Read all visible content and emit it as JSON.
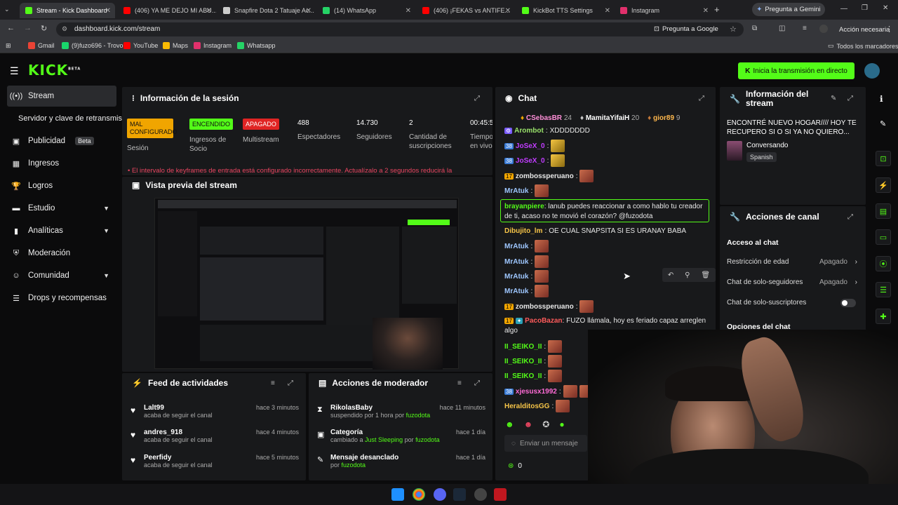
{
  "browser": {
    "tabs": [
      {
        "label": "Stream - Kick Dashboard",
        "color": "#53fc18",
        "active": true
      },
      {
        "label": "(406) YA ME DEJO MI ABU...",
        "color": "#ff0000"
      },
      {
        "label": "Snapfire Dota 2 Tatuaje Ac...",
        "color": "#cccccc"
      },
      {
        "label": "(14) WhatsApp",
        "color": "#25d366"
      },
      {
        "label": "(406) ¡FEKAS vs ANTIFE...",
        "color": "#ff0000"
      },
      {
        "label": "KickBot TTS Settings",
        "color": "#53fc18"
      },
      {
        "label": "Instagram",
        "color": "#e1306c"
      }
    ],
    "gemini_button": "Pregunta a Gemini",
    "url": "dashboard.kick.com/stream",
    "ask_google": "Pregunta a Google",
    "action_needed": "Acción necesaria",
    "bookmarks": [
      "Gmail",
      "(9)fuzo696 - Trovo",
      "YouTube",
      "Maps",
      "Instagram",
      "Whatsapp"
    ],
    "all_bookmarks": "Todos los marcadores"
  },
  "header": {
    "logo": "KICK",
    "logo_sup": "BETA",
    "go_live": "Inicia la transmisión en directo"
  },
  "sidebar": {
    "items": [
      {
        "label": "Stream",
        "icon": "signal-icon"
      },
      {
        "label": "Servidor y clave de retransmisión"
      },
      {
        "label": "Publicidad",
        "badge": "Beta"
      },
      {
        "label": "Ingresos"
      },
      {
        "label": "Logros"
      },
      {
        "label": "Estudio"
      },
      {
        "label": "Analíticas"
      },
      {
        "label": "Moderación"
      },
      {
        "label": "Comunidad"
      },
      {
        "label": "Drops y recompensas"
      }
    ]
  },
  "session": {
    "title": "Información de la sesión",
    "stats": [
      {
        "badge": "MAL CONFIGURADO",
        "label": "Sesión",
        "color": "#f0a500"
      },
      {
        "badge": "ENCENDIDO",
        "label": "Ingresos de Socio",
        "color": "#53fc18"
      },
      {
        "badge": "APAGADO",
        "label": "Multistream",
        "color": "#e02424"
      },
      {
        "value": "488",
        "label": "Espectadores"
      },
      {
        "value": "14.730",
        "label": "Seguidores"
      },
      {
        "value": "2",
        "label": "Cantidad de suscripciones"
      },
      {
        "value": "00:45:5",
        "label": "Tiempo en vivo"
      }
    ],
    "warning": "El intervalo de keyframes de entrada está configurado incorrectamente. Actualízalo a 2 segundos reducirá la"
  },
  "preview": {
    "title": "Vista previa del stream"
  },
  "activity": {
    "title": "Feed de actividades",
    "items": [
      {
        "name": "Lalt99",
        "sub": "acaba de seguir el canal",
        "time": "hace 3 minutos"
      },
      {
        "name": "andres_918",
        "sub": "acaba de seguir el canal",
        "time": "hace 4 minutos"
      },
      {
        "name": "Peerfidy",
        "sub": "acaba de seguir el canal",
        "time": "hace 5 minutos"
      }
    ]
  },
  "modactions": {
    "title": "Acciones de moderador",
    "items": [
      {
        "name": "RikolasBaby",
        "sub": "suspendido por 1 hora por",
        "by": "fuzodota",
        "time": "hace 11 minutos"
      },
      {
        "name": "Categoría",
        "sub": "cambiado a",
        "target": "Just Sleeping",
        "by_pre": "por",
        "by": "fuzodota",
        "time": "hace 1 día"
      },
      {
        "name": "Mensaje desanclado",
        "sub": "por",
        "by": "fuzodota",
        "time": "hace 1 día"
      }
    ]
  },
  "chat": {
    "title": "Chat",
    "top_gifters": [
      {
        "name": "CSebasBR",
        "count": "24"
      },
      {
        "name": "MamitaYifaiH",
        "count": "20"
      },
      {
        "name": "gior89",
        "count": "9"
      }
    ],
    "messages": [
      {
        "user": "Arombot",
        "text": "XDDDDDDD",
        "color": "#9ae36b"
      },
      {
        "user": "JoSeX_0",
        "text": "",
        "color": "#c13cff",
        "badge": "38",
        "emote": "y"
      },
      {
        "user": "JoSeX_0",
        "text": "",
        "color": "#c13cff",
        "badge": "38",
        "emote": "y"
      },
      {
        "user": "zombossperuano",
        "text": "",
        "color": "#ffffff",
        "badge": "17",
        "emote": "r"
      },
      {
        "user": "MrAtuk",
        "text": "",
        "color": "#9ec7ff",
        "emote": "r"
      },
      {
        "user": "brayanpiere",
        "text": "lanub puedes reaccionar a como hablo tu creador",
        "text2": "de ti, acaso no te movió el corazón? @fuzodota",
        "color": "#53fc18",
        "highlight": true
      },
      {
        "user": "Dibujito_lm",
        "text": "OE CUAL SNAPSITA SI ES URANAY BABA",
        "color": "#f7c548"
      },
      {
        "user": "MrAtuk",
        "text": "",
        "color": "#9ec7ff",
        "emote": "r"
      },
      {
        "user": "MrAtuk",
        "text": "",
        "color": "#9ec7ff",
        "emote": "r"
      },
      {
        "user": "MrAtuk",
        "text": "",
        "color": "#9ec7ff",
        "emote": "r"
      },
      {
        "user": "MrAtuk",
        "text": "",
        "color": "#9ec7ff",
        "emote": "r"
      },
      {
        "user": "zombossperuano",
        "text": "",
        "color": "#ffffff",
        "badge": "17",
        "emote": "r"
      },
      {
        "user": "PacoBazan",
        "text": "FUZO llámala, hoy es feriado capaz arreglen",
        "text2": "algo",
        "color": "#ff5b5b",
        "badge": "17"
      },
      {
        "user": "II_SEIKO_II",
        "text": "",
        "color": "#53fc18",
        "emote": "r"
      },
      {
        "user": "II_SEIKO_II",
        "text": "",
        "color": "#53fc18",
        "emote": "r"
      },
      {
        "user": "II_SEIKO_II",
        "text": "",
        "color": "#53fc18",
        "emote": "r"
      },
      {
        "user": "xjesusx1992",
        "text": "",
        "color": "#ff6bd6",
        "badge": "38",
        "emote": "r"
      },
      {
        "user": "HeralditosGG",
        "text": "",
        "color": "#f7c548",
        "emote": "r"
      }
    ],
    "send_placeholder": "Enviar un mensaje",
    "points": "0"
  },
  "sessioninfo": {
    "title": "Información del stream",
    "stream_title": "ENCONTRÉ NUEVO HOGAR//// HOY TE RECUPERO SI O SI YA NO QUIERO...",
    "category": "Conversando",
    "language": "Spanish"
  },
  "channel": {
    "title": "Acciones de canal",
    "access_title": "Acceso al chat",
    "rows": [
      {
        "label": "Restricción de edad",
        "value": "Apagado"
      },
      {
        "label": "Chat de solo-seguidores",
        "value": "Apagado"
      },
      {
        "label": "Chat de solo-suscriptores",
        "value": ""
      }
    ],
    "options_title": "Opciones del chat"
  },
  "colors": {
    "accent": "#53fc18",
    "panel": "#18191b",
    "bg": "#0b0b0c"
  }
}
